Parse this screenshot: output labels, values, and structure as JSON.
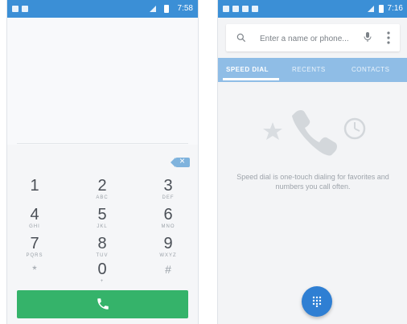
{
  "left_phone": {
    "status_time": "7:58",
    "keypad": [
      {
        "num": "1",
        "letters": "",
        "sym": ""
      },
      {
        "num": "2",
        "letters": "ABC",
        "sym": ""
      },
      {
        "num": "3",
        "letters": "DEF",
        "sym": ""
      },
      {
        "num": "4",
        "letters": "GHI",
        "sym": ""
      },
      {
        "num": "5",
        "letters": "JKL",
        "sym": ""
      },
      {
        "num": "6",
        "letters": "MNO",
        "sym": ""
      },
      {
        "num": "7",
        "letters": "PQRS",
        "sym": ""
      },
      {
        "num": "8",
        "letters": "TUV",
        "sym": ""
      },
      {
        "num": "9",
        "letters": "WXYZ",
        "sym": ""
      },
      {
        "num": "",
        "letters": "",
        "sym": "*"
      },
      {
        "num": "0",
        "letters": "+",
        "sym": ""
      },
      {
        "num": "",
        "letters": "",
        "sym": "#"
      }
    ]
  },
  "right_phone": {
    "status_time": "7:16",
    "search": {
      "placeholder": "Enter a name or phone..."
    },
    "tabs": [
      "SPEED DIAL",
      "RECENTS",
      "CONTACTS"
    ],
    "empty_message": "Speed dial is one-touch dialing for favorites and numbers you call often."
  },
  "colors": {
    "status_blue": "#3b8fd6",
    "tab_blue": "#8fbde6",
    "call_green": "#35b36a",
    "fab_blue": "#2f7fd3"
  },
  "icons": [
    "search-icon",
    "mic-icon",
    "more-icon",
    "backspace-icon",
    "phone-icon",
    "star-icon",
    "clock-icon",
    "dialpad-icon"
  ]
}
